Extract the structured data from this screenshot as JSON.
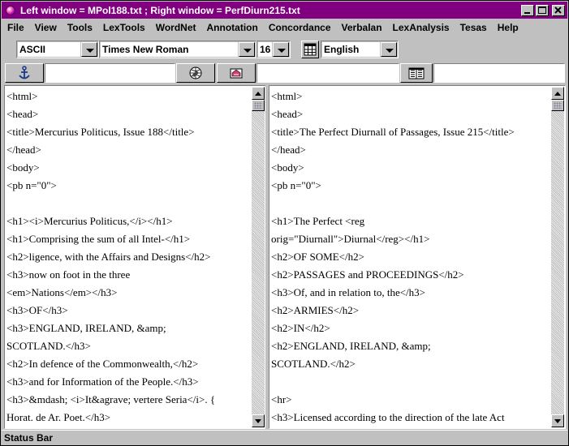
{
  "window": {
    "title": "Left window =  MPol188.txt ; Right window =  PerfDiurn215.txt",
    "app_icon": "pink-ball-icon",
    "controls": {
      "minimize": "_",
      "maximize": "□",
      "close": "✕"
    }
  },
  "menubar": {
    "items": [
      "File",
      "View",
      "Tools",
      "LexTools",
      "WordNet",
      "Annotation",
      "Concordance",
      "Verbalan",
      "LexAnalysis",
      "Tesas",
      "Help"
    ]
  },
  "toolbar": {
    "encoding": "ASCII",
    "font": "Times New Roman",
    "font_size": "16",
    "language": "English",
    "grid_icon": "grid-icon",
    "anchor_icon": "anchor-icon",
    "globe_icon": "globe-icon",
    "image_icon": "image-icon",
    "book_icon": "book-icon"
  },
  "left_pane": {
    "lines": [
      "<html>",
      "<head>",
      "<title>Mercurius Politicus, Issue 188</title>",
      "</head>",
      "<body>",
      "<pb n=\"0\">",
      "",
      "<h1><i>Mercurius Politicus,</i></h1>",
      "<h1>Comprising the sum of all Intel-</h1>",
      "<h2>ligence, with the Affairs and Designs</h2>",
      "<h3>now on foot in the three",
      "<em>Nations</em></h3>",
      "<h3>OF</h3>",
      "<h3>ENGLAND, IRELAND, &amp;",
      "SCOTLAND.</h3>",
      "<h2>In defence of the Commonwealth,</h2>",
      "<h3>and for Information of the People.</h3>",
      "<h3>&mdash; <i>It&agrave; vertere Seria</i>. {",
      "Horat. de Ar. Poet.</h3>"
    ]
  },
  "right_pane": {
    "lines": [
      "<html>",
      "<head>",
      "<title>The Perfect Diurnall of Passages, Issue 215</title>",
      "</head>",
      "<body>",
      "<pb n=\"0\">",
      "",
      "<h1>The Perfect <reg",
      "orig=\"Diurnall\">Diurnal</reg></h1>",
      "<h2>OF SOME</h2>",
      "<h2>PASSAGES and PROCEEDINGS</h2>",
      "<h3>Of, and in relation to, the</h3>",
      "<h2>ARMIES</h2>",
      "<h2>IN</h2>",
      "<h2>ENGLAND, IRELAND, &amp;",
      "SCOTLAND.</h2>",
      "",
      "<hr>",
      "<h3>Licensed according to the direction of the late Act"
    ]
  },
  "statusbar": {
    "text": "Status Bar"
  }
}
